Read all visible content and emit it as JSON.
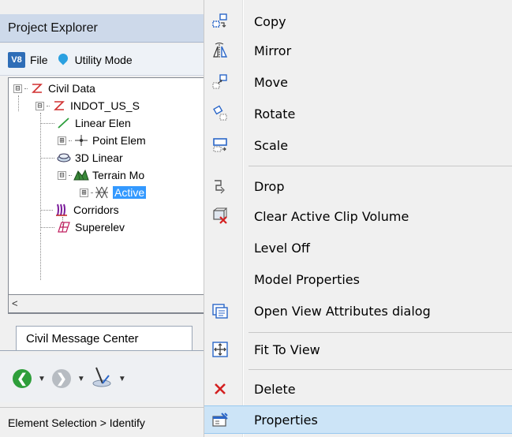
{
  "project_explorer": {
    "title": "Project Explorer",
    "toolbar": {
      "v8_badge": "V8",
      "file_label": "File",
      "utility_label": "Utility Mode"
    },
    "tree": {
      "nodes": [
        {
          "label": "Civil Data",
          "expander": "⊟",
          "icon": "civil-data-icon"
        },
        {
          "label": "INDOT_US_S",
          "expander": "⊟",
          "icon": "civil-model-icon"
        },
        {
          "label": "Linear Elen",
          "expander": "",
          "icon": "linear-element-icon"
        },
        {
          "label": "Point Elem",
          "expander": "⊞",
          "icon": "point-element-icon"
        },
        {
          "label": "3D Linear",
          "expander": "",
          "icon": "3d-linear-icon"
        },
        {
          "label": "Terrain Mo",
          "expander": "⊟",
          "icon": "terrain-model-icon"
        },
        {
          "label": "Active",
          "expander": "⊞",
          "icon": "terrain-active-icon",
          "selected": true
        },
        {
          "label": "Corridors",
          "expander": "",
          "icon": "corridors-icon"
        },
        {
          "label": "Superelev",
          "expander": "",
          "icon": "superelevation-icon"
        }
      ]
    },
    "scroll_left": "<"
  },
  "message_center": {
    "tab_label": "Civil Message Center"
  },
  "status_bar": {
    "text": "Element Selection > Identify"
  },
  "context_menu": {
    "items": [
      {
        "label": "Copy",
        "icon": "copy-icon"
      },
      {
        "label": "Mirror",
        "icon": "mirror-icon"
      },
      {
        "label": "Move",
        "icon": "move-icon"
      },
      {
        "label": "Rotate",
        "icon": "rotate-icon"
      },
      {
        "label": "Scale",
        "icon": "scale-icon"
      },
      {
        "label": "Drop",
        "icon": "drop-icon"
      },
      {
        "label": "Clear Active Clip Volume",
        "icon": "clear-clip-volume-icon"
      },
      {
        "label": "Level Off",
        "icon": ""
      },
      {
        "label": "Model Properties",
        "icon": ""
      },
      {
        "label": "Open View Attributes dialog",
        "icon": "view-attributes-icon"
      },
      {
        "label": "Fit To View",
        "icon": "fit-to-view-icon"
      },
      {
        "label": "Delete",
        "icon": "delete-icon"
      },
      {
        "label": "Properties",
        "icon": "properties-icon",
        "highlighted": true
      }
    ]
  },
  "colors": {
    "menu_highlight": "#cce4f7",
    "tree_selection": "#3399ff",
    "title_bar": "#cdd9ea",
    "delete_red": "#d42020"
  }
}
